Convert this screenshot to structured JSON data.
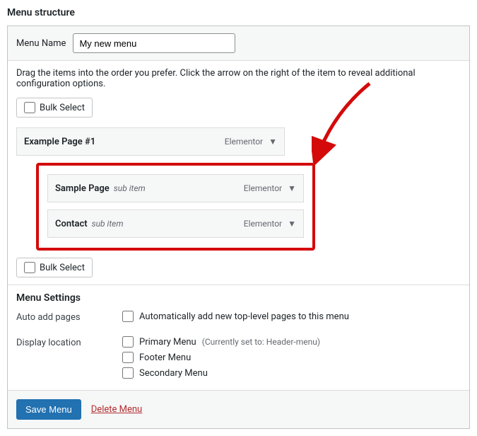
{
  "heading": "Menu structure",
  "menu_name_label": "Menu Name",
  "menu_name_value": "My new menu",
  "instructions": "Drag the items into the order you prefer. Click the arrow on the right of the item to reveal additional configuration options.",
  "bulk_select_label": "Bulk Select",
  "sub_item_label": "sub item",
  "items": [
    {
      "title": "Example Page #1",
      "type": "Elementor",
      "sub": false
    },
    {
      "title": "Sample Page",
      "type": "Elementor",
      "sub": true
    },
    {
      "title": "Contact",
      "type": "Elementor",
      "sub": true
    }
  ],
  "settings": {
    "heading": "Menu Settings",
    "auto_add_label": "Auto add pages",
    "auto_add_text": "Automatically add new top-level pages to this menu",
    "display_location_label": "Display location",
    "locations": [
      {
        "label": "Primary Menu",
        "hint": "(Currently set to: Header-menu)"
      },
      {
        "label": "Footer Menu",
        "hint": ""
      },
      {
        "label": "Secondary Menu",
        "hint": ""
      }
    ]
  },
  "footer": {
    "save_label": "Save Menu",
    "delete_label": "Delete Menu"
  },
  "annotation": {
    "color": "#d40a0a"
  }
}
